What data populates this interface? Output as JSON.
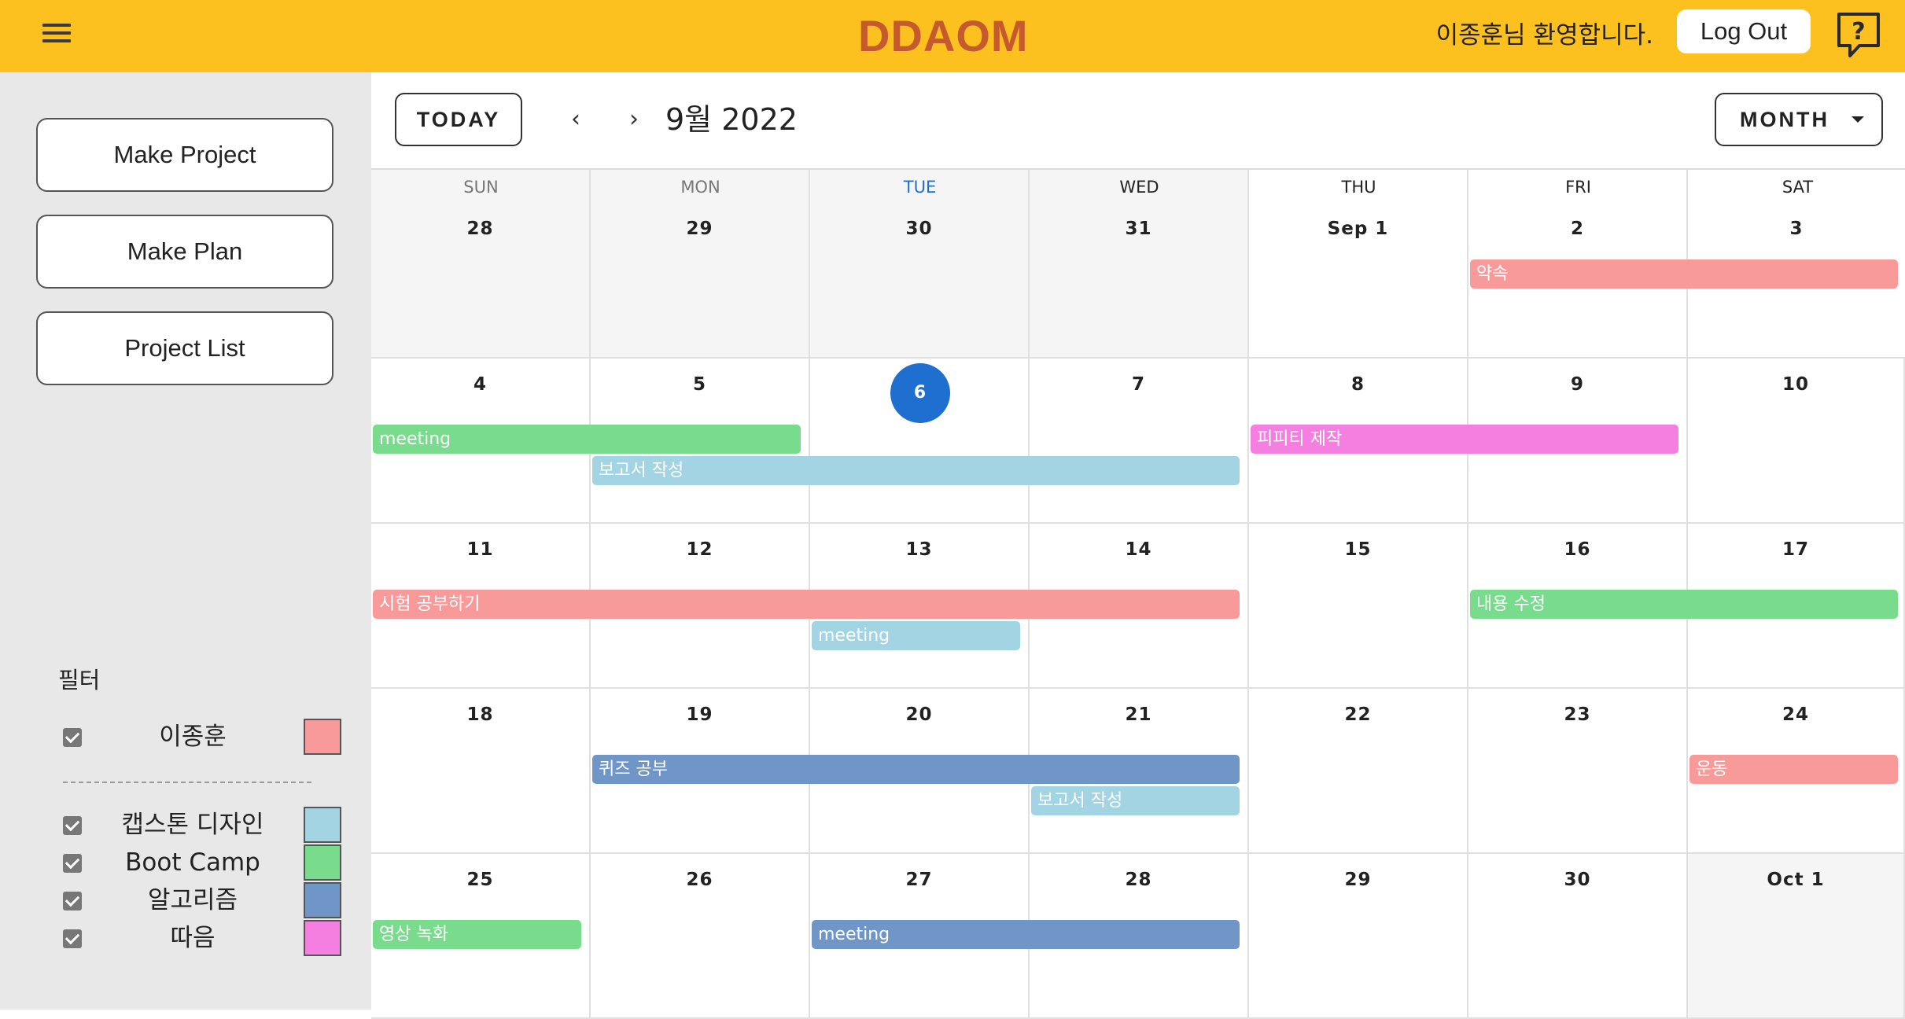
{
  "header": {
    "logo": "DDAOM",
    "welcome": "이종훈님 환영합니다.",
    "logout_label": "Log Out"
  },
  "sidebar": {
    "buttons": [
      "Make Project",
      "Make Plan",
      "Project List"
    ],
    "filter_title": "필터",
    "filters": [
      {
        "label": "이종훈",
        "color": "#f89a9a",
        "checked": true
      },
      {
        "label": "캡스톤 디자인",
        "color": "#a3d4e3",
        "checked": true
      },
      {
        "label": "Boot Camp",
        "color": "#79db8c",
        "checked": true
      },
      {
        "label": "알고리즘",
        "color": "#7095c7",
        "checked": true
      },
      {
        "label": "따음",
        "color": "#f47fe0",
        "checked": true
      }
    ]
  },
  "toolbar": {
    "today_label": "TODAY",
    "prev_icon": "‹",
    "next_icon": "›",
    "month_title": "9월 2022",
    "view_label": "MONTH"
  },
  "calendar": {
    "weekdays": [
      "SUN",
      "MON",
      "TUE",
      "WED",
      "THU",
      "FRI",
      "SAT"
    ],
    "highlight_weekday_index": 2,
    "highlight_weekday_color": "#1e6fd0",
    "weeks": [
      [
        "28",
        "29",
        "30",
        "31",
        "Sep 1",
        "2",
        "3"
      ],
      [
        "4",
        "5",
        "6",
        "7",
        "8",
        "9",
        "10"
      ],
      [
        "11",
        "12",
        "13",
        "14",
        "15",
        "16",
        "17"
      ],
      [
        "18",
        "19",
        "20",
        "21",
        "22",
        "23",
        "24"
      ],
      [
        "25",
        "26",
        "27",
        "28",
        "29",
        "30",
        "Oct 1"
      ]
    ],
    "today": "6",
    "colors": {
      "pink": "#f89a9a",
      "blue": "#a3d4e3",
      "green": "#79db8c",
      "navy": "#7095c7",
      "magenta": "#f47fe0",
      "today": "#1e6fd0",
      "accent": "#fcc11f",
      "logo": "#c65a2f"
    },
    "events": [
      {
        "title": "약속",
        "week": 0,
        "start": 5,
        "span": 2,
        "lane": 0,
        "color": "pink"
      },
      {
        "title": "meeting",
        "week": 1,
        "start": 0,
        "span": 2,
        "lane": 0,
        "color": "green"
      },
      {
        "title": "보고서 작성",
        "week": 1,
        "start": 1,
        "span": 3,
        "lane": 1,
        "color": "blue"
      },
      {
        "title": "피피티 제작",
        "week": 1,
        "start": 4,
        "span": 2,
        "lane": 0,
        "color": "magenta"
      },
      {
        "title": "시험 공부하기",
        "week": 2,
        "start": 0,
        "span": 4,
        "lane": 0,
        "color": "pink"
      },
      {
        "title": "meeting",
        "week": 2,
        "start": 2,
        "span": 1,
        "lane": 1,
        "color": "blue"
      },
      {
        "title": "내용 수정",
        "week": 2,
        "start": 5,
        "span": 2,
        "lane": 0,
        "color": "green"
      },
      {
        "title": "퀴즈 공부",
        "week": 3,
        "start": 1,
        "span": 3,
        "lane": 0,
        "color": "navy"
      },
      {
        "title": "보고서 작성",
        "week": 3,
        "start": 3,
        "span": 1,
        "lane": 1,
        "color": "blue"
      },
      {
        "title": "운동",
        "week": 3,
        "start": 6,
        "span": 1,
        "lane": 0,
        "color": "pink"
      },
      {
        "title": "영상 녹화",
        "week": 4,
        "start": 0,
        "span": 1,
        "lane": 0,
        "color": "green"
      },
      {
        "title": "meeting",
        "week": 4,
        "start": 2,
        "span": 2,
        "lane": 0,
        "color": "navy"
      }
    ]
  }
}
